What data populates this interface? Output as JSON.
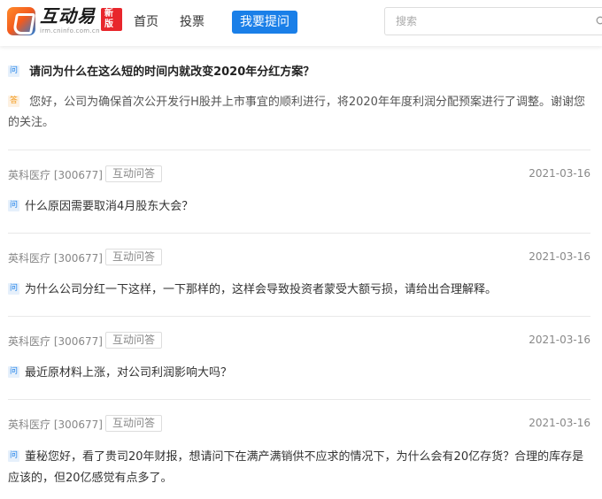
{
  "header": {
    "logo_text": "互动易",
    "logo_badge": "新版",
    "logo_url": "irm.cninfo.com.cn",
    "nav": {
      "home": "首页",
      "vote": "投票",
      "ask": "我要提问"
    },
    "search": {
      "placeholder": "搜索"
    }
  },
  "top_qa": {
    "q_tag": "问",
    "question": "请问为什么在这么短的时间内就改变2020年分红方案？",
    "a_tag": "答",
    "answer": "您好，公司为确保首次公开发行H股并上市事宜的顺利进行，将2020年年度利润分配预案进行了调整。谢谢您的关注。"
  },
  "items": [
    {
      "company": "英科医疗 [300677]",
      "type": "互动问答",
      "date": "2021-03-16",
      "q_tag": "问",
      "question": "什么原因需要取消4月股东大会？"
    },
    {
      "company": "英科医疗 [300677]",
      "type": "互动问答",
      "date": "2021-03-16",
      "q_tag": "问",
      "question": "为什么公司分红一下这样，一下那样的，这样会导致投资者蒙受大额亏损，请给出合理解释。"
    },
    {
      "company": "英科医疗 [300677]",
      "type": "互动问答",
      "date": "2021-03-16",
      "q_tag": "问",
      "question": "最近原材料上涨，对公司利润影响大吗？"
    },
    {
      "company": "英科医疗 [300677]",
      "type": "互动问答",
      "date": "2021-03-16",
      "q_tag": "问",
      "question": "董秘您好，看了贵司20年财报，想请问下在满产满销供不应求的情况下，为什么会有20亿存货？合理的库存是应该的，但20亿感觉有点多了。"
    }
  ]
}
